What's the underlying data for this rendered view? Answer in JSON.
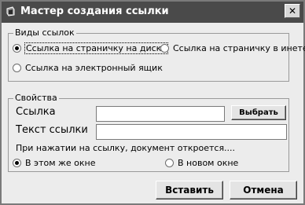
{
  "window": {
    "title": "Мастер создания ссылки",
    "close_symbol": "✕"
  },
  "link_types": {
    "group_label": "Виды ссылок",
    "options": [
      {
        "label": "Ссылка на страничку на диске",
        "checked": true
      },
      {
        "label": "Ссылка на страничку в инете",
        "checked": false
      },
      {
        "label": "Ссылка на электронный ящик",
        "checked": false
      }
    ]
  },
  "properties": {
    "group_label": "Свойства",
    "link_label": "Ссылка",
    "link_value": "",
    "browse_label": "Выбрать",
    "text_label": "Текст ссылки",
    "text_value": "",
    "open_hint": "При нажатии на ссылку, документ откроется....",
    "open_options": [
      {
        "label": "В этом же окне",
        "checked": true
      },
      {
        "label": "В новом окне",
        "checked": false
      }
    ]
  },
  "footer": {
    "insert_label": "Вставить",
    "cancel_label": "Отмена"
  },
  "icons": {
    "app": "app-icon",
    "close": "close-icon"
  }
}
